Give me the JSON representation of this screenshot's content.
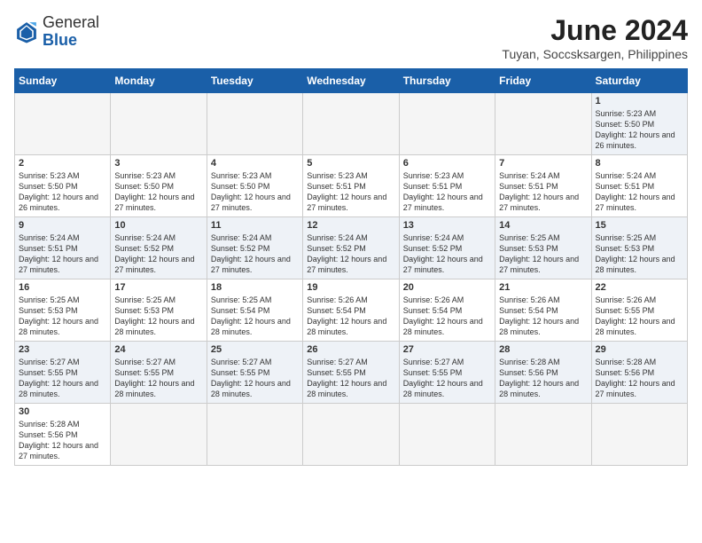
{
  "header": {
    "logo_general": "General",
    "logo_blue": "Blue",
    "month_year": "June 2024",
    "location": "Tuyan, Soccsksargen, Philippines"
  },
  "days_of_week": [
    "Sunday",
    "Monday",
    "Tuesday",
    "Wednesday",
    "Thursday",
    "Friday",
    "Saturday"
  ],
  "weeks": [
    [
      {
        "day": "",
        "info": ""
      },
      {
        "day": "",
        "info": ""
      },
      {
        "day": "",
        "info": ""
      },
      {
        "day": "",
        "info": ""
      },
      {
        "day": "",
        "info": ""
      },
      {
        "day": "",
        "info": ""
      },
      {
        "day": "1",
        "info": "Sunrise: 5:23 AM\nSunset: 5:50 PM\nDaylight: 12 hours and 26 minutes."
      }
    ],
    [
      {
        "day": "2",
        "info": "Sunrise: 5:23 AM\nSunset: 5:50 PM\nDaylight: 12 hours and 26 minutes."
      },
      {
        "day": "3",
        "info": "Sunrise: 5:23 AM\nSunset: 5:50 PM\nDaylight: 12 hours and 27 minutes."
      },
      {
        "day": "4",
        "info": "Sunrise: 5:23 AM\nSunset: 5:50 PM\nDaylight: 12 hours and 27 minutes."
      },
      {
        "day": "5",
        "info": "Sunrise: 5:23 AM\nSunset: 5:51 PM\nDaylight: 12 hours and 27 minutes."
      },
      {
        "day": "6",
        "info": "Sunrise: 5:23 AM\nSunset: 5:51 PM\nDaylight: 12 hours and 27 minutes."
      },
      {
        "day": "7",
        "info": "Sunrise: 5:24 AM\nSunset: 5:51 PM\nDaylight: 12 hours and 27 minutes."
      },
      {
        "day": "8",
        "info": "Sunrise: 5:24 AM\nSunset: 5:51 PM\nDaylight: 12 hours and 27 minutes."
      }
    ],
    [
      {
        "day": "9",
        "info": "Sunrise: 5:24 AM\nSunset: 5:51 PM\nDaylight: 12 hours and 27 minutes."
      },
      {
        "day": "10",
        "info": "Sunrise: 5:24 AM\nSunset: 5:52 PM\nDaylight: 12 hours and 27 minutes."
      },
      {
        "day": "11",
        "info": "Sunrise: 5:24 AM\nSunset: 5:52 PM\nDaylight: 12 hours and 27 minutes."
      },
      {
        "day": "12",
        "info": "Sunrise: 5:24 AM\nSunset: 5:52 PM\nDaylight: 12 hours and 27 minutes."
      },
      {
        "day": "13",
        "info": "Sunrise: 5:24 AM\nSunset: 5:52 PM\nDaylight: 12 hours and 27 minutes."
      },
      {
        "day": "14",
        "info": "Sunrise: 5:25 AM\nSunset: 5:53 PM\nDaylight: 12 hours and 27 minutes."
      },
      {
        "day": "15",
        "info": "Sunrise: 5:25 AM\nSunset: 5:53 PM\nDaylight: 12 hours and 28 minutes."
      }
    ],
    [
      {
        "day": "16",
        "info": "Sunrise: 5:25 AM\nSunset: 5:53 PM\nDaylight: 12 hours and 28 minutes."
      },
      {
        "day": "17",
        "info": "Sunrise: 5:25 AM\nSunset: 5:53 PM\nDaylight: 12 hours and 28 minutes."
      },
      {
        "day": "18",
        "info": "Sunrise: 5:25 AM\nSunset: 5:54 PM\nDaylight: 12 hours and 28 minutes."
      },
      {
        "day": "19",
        "info": "Sunrise: 5:26 AM\nSunset: 5:54 PM\nDaylight: 12 hours and 28 minutes."
      },
      {
        "day": "20",
        "info": "Sunrise: 5:26 AM\nSunset: 5:54 PM\nDaylight: 12 hours and 28 minutes."
      },
      {
        "day": "21",
        "info": "Sunrise: 5:26 AM\nSunset: 5:54 PM\nDaylight: 12 hours and 28 minutes."
      },
      {
        "day": "22",
        "info": "Sunrise: 5:26 AM\nSunset: 5:55 PM\nDaylight: 12 hours and 28 minutes."
      }
    ],
    [
      {
        "day": "23",
        "info": "Sunrise: 5:27 AM\nSunset: 5:55 PM\nDaylight: 12 hours and 28 minutes."
      },
      {
        "day": "24",
        "info": "Sunrise: 5:27 AM\nSunset: 5:55 PM\nDaylight: 12 hours and 28 minutes."
      },
      {
        "day": "25",
        "info": "Sunrise: 5:27 AM\nSunset: 5:55 PM\nDaylight: 12 hours and 28 minutes."
      },
      {
        "day": "26",
        "info": "Sunrise: 5:27 AM\nSunset: 5:55 PM\nDaylight: 12 hours and 28 minutes."
      },
      {
        "day": "27",
        "info": "Sunrise: 5:27 AM\nSunset: 5:55 PM\nDaylight: 12 hours and 28 minutes."
      },
      {
        "day": "28",
        "info": "Sunrise: 5:28 AM\nSunset: 5:56 PM\nDaylight: 12 hours and 28 minutes."
      },
      {
        "day": "29",
        "info": "Sunrise: 5:28 AM\nSunset: 5:56 PM\nDaylight: 12 hours and 27 minutes."
      }
    ],
    [
      {
        "day": "30",
        "info": "Sunrise: 5:28 AM\nSunset: 5:56 PM\nDaylight: 12 hours and 27 minutes."
      },
      {
        "day": "",
        "info": ""
      },
      {
        "day": "",
        "info": ""
      },
      {
        "day": "",
        "info": ""
      },
      {
        "day": "",
        "info": ""
      },
      {
        "day": "",
        "info": ""
      },
      {
        "day": "",
        "info": ""
      }
    ]
  ]
}
